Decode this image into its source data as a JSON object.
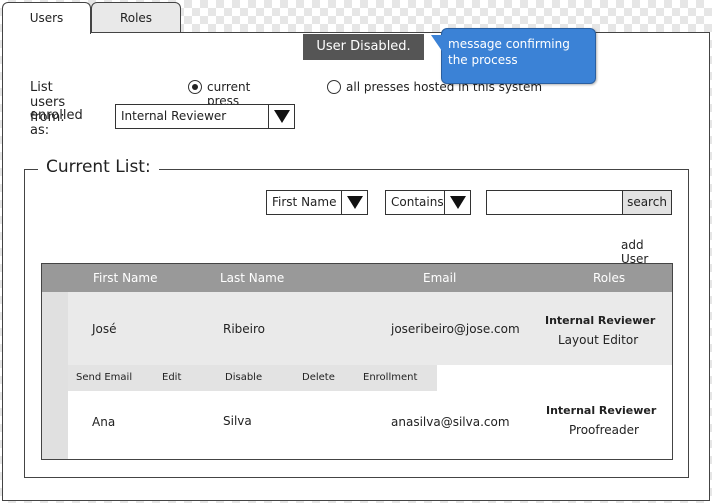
{
  "tabs": [
    {
      "label": "Users",
      "active": true
    },
    {
      "label": "Roles",
      "active": false
    }
  ],
  "toast": {
    "text": "User Disabled."
  },
  "callout": {
    "text": "message confirming the process"
  },
  "filters": {
    "list_from_label": "List users from:",
    "radio_current": "current press",
    "radio_all": "all presses hosted in this system",
    "enrolled_label": "enrolled as:",
    "enrolled_value": "Internal Reviewer"
  },
  "current_list": {
    "title": "Current List:",
    "field_select": "First Name",
    "match_select": "Contains",
    "search_value": "",
    "search_button": "search",
    "add_user": "add User"
  },
  "table": {
    "headers": [
      "First Name",
      "Last Name",
      "Email",
      "Roles"
    ],
    "rows": [
      {
        "first": "José",
        "last": "Ribeiro",
        "email": "joseribeiro@jose.com",
        "role_primary": "Internal Reviewer",
        "role_secondary": "Layout Editor"
      },
      {
        "first": "Ana",
        "last": "Silva",
        "email": "anasilva@silva.com",
        "role_primary": "Internal Reviewer",
        "role_secondary": "Proofreader"
      }
    ],
    "actions": [
      "Send Email",
      "Edit",
      "Disable",
      "Delete",
      "Enrollment"
    ]
  }
}
